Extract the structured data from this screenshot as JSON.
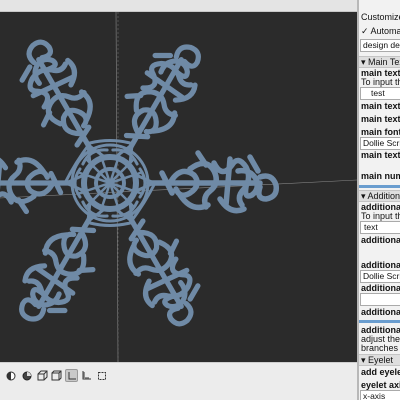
{
  "panel": {
    "title": "Customizer",
    "automatic_preview_label": "✓ Automatio",
    "preset_select": "design defa",
    "sections": {
      "main_text": "▾ Main Text",
      "additional": "▾ Additiona",
      "eyelet": "▾ Eyelet"
    },
    "main_text": {
      "label": "main text",
      "hint": "To input the",
      "value": "test",
      "size_label": "main text s",
      "weight_label": "main text w",
      "font_label": "main font",
      "font_value": "Dollie Scrip",
      "spacing_label": "main text s",
      "number_label": "main numb"
    },
    "additional": {
      "label": "additional",
      "hint": "To input the",
      "value": "text",
      "label2": "additional",
      "label3": "additional",
      "font_value": "Dollie Scrip",
      "label4": "additional",
      "label5": "additional",
      "label6": "additional",
      "adjust_hint_1": "adjust the n",
      "adjust_hint_2": "branches"
    },
    "eyelet": {
      "add_label": "add eyelet",
      "axis_label": "eyelet axis",
      "axis_value": "x-axis"
    }
  },
  "viewport": {
    "background": "#2b2b2b",
    "model_color": "#6f8aa6",
    "model_text": "test"
  },
  "toolbar": {
    "icons": [
      "preview-render-icon",
      "full-render-icon",
      "perspective-icon",
      "orthogonal-icon",
      "show-axes-icon",
      "show-scale-icon",
      "show-edges-icon"
    ]
  }
}
